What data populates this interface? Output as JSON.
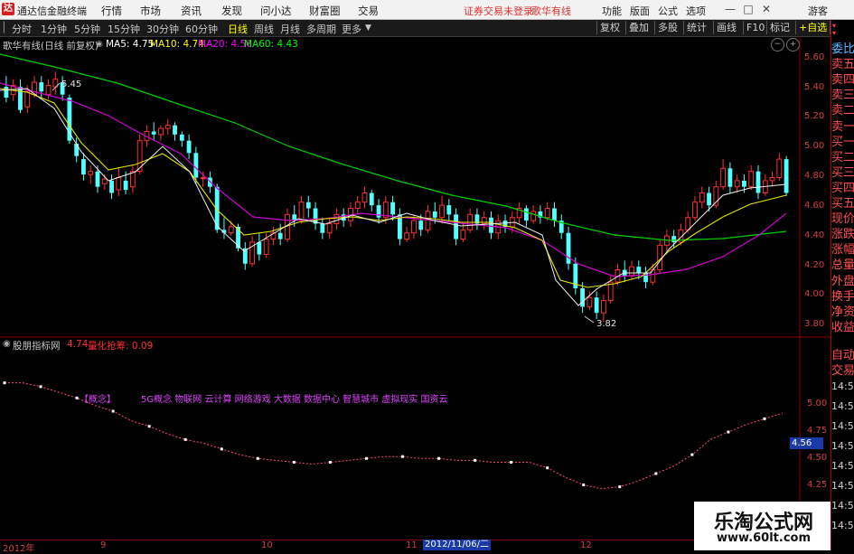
{
  "titlebar": {
    "logo": "达",
    "app_title": "通达信金融终端",
    "menus": [
      "行情",
      "市场",
      "资讯",
      "发现",
      "问小达",
      "财富圈",
      "交易"
    ],
    "warning": "证券交易未登录",
    "stock_name": "歌华有线",
    "right_menus": [
      "功能",
      "版面",
      "公式",
      "选项"
    ],
    "guest": "游客",
    "win_min": "—",
    "win_max": "□",
    "win_close": "✕"
  },
  "toolbar": {
    "periods": [
      "分时",
      "1分钟",
      "5分钟",
      "15分钟",
      "30分钟",
      "60分钟",
      "日线",
      "周线",
      "月线",
      "多周期",
      "更多"
    ],
    "selected": "日线",
    "right_buttons": [
      "复权",
      "叠加",
      "多股",
      "统计",
      "画线",
      "F10",
      "标记",
      "+自选",
      "返回"
    ]
  },
  "chart_header": {
    "name": "歌华有线(日线 前复权)",
    "ma5": "MA5: 4.75",
    "ma10": "MA10: 4.74",
    "ma20": "MA20: 4.56",
    "ma60": "MA60: 4.43",
    "colors": {
      "ma5": "#ffffff",
      "ma10": "#ffff00",
      "ma20": "#ff00ff",
      "ma60": "#00ff00"
    }
  },
  "indicator_header": {
    "name": "股朋指标网",
    "value": "4.74",
    "label2": "量化抢筹: 0.09",
    "concept": "【概念】",
    "concept_text": "5G概念 物联网 云计算 网络游戏 大数据 数据中心 智慧城市 虚拟现实 国资云",
    "current_tag": "4.56"
  },
  "side_panel": {
    "top_labels": [
      "委比",
      "卖五",
      "卖四",
      "卖三",
      "卖二",
      "卖一",
      "买一",
      "买二",
      "买三",
      "买四",
      "买五",
      "现价",
      "涨跌",
      "涨幅",
      "总量",
      "外盘",
      "换手",
      "净资",
      "收益"
    ],
    "lower_labels": [
      "自动",
      "交易"
    ],
    "times": [
      "14:56",
      "14:56",
      "14:56",
      "14:56",
      "14:56",
      "14:56",
      "14:56",
      "14:56"
    ]
  },
  "price_axis": [
    "5.60",
    "5.40",
    "5.20",
    "5.00",
    "4.80",
    "4.60",
    "4.40",
    "4.20",
    "4.00",
    "3.80"
  ],
  "indicator_axis": [
    "5.00",
    "4.75",
    "4.50",
    "4.25"
  ],
  "annotations": {
    "high": "5.45",
    "low": "3.82"
  },
  "timeline": {
    "labels": [
      "2012年",
      "9",
      "10",
      "11",
      "12"
    ],
    "cursor_date": "2012/11/06/二"
  },
  "watermark": {
    "line1": "乐淘公式网",
    "line2": "www.60lt.com"
  },
  "chart_data": {
    "type": "candlestick",
    "colors": {
      "up": "#ff3030",
      "down": "#54ffff"
    },
    "ylim": [
      3.74,
      5.68
    ],
    "candles": [
      [
        5.35,
        5.28,
        5.42,
        5.25
      ],
      [
        5.3,
        5.36,
        5.4,
        5.26
      ],
      [
        5.35,
        5.2,
        5.4,
        5.18
      ],
      [
        5.22,
        5.32,
        5.36,
        5.18
      ],
      [
        5.3,
        5.38,
        5.42,
        5.28
      ],
      [
        5.38,
        5.32,
        5.42,
        5.28
      ],
      [
        5.3,
        5.36,
        5.4,
        5.27
      ],
      [
        5.35,
        5.4,
        5.45,
        5.3
      ],
      [
        5.38,
        5.3,
        5.42,
        5.26
      ],
      [
        5.28,
        5.0,
        5.3,
        4.98
      ],
      [
        4.98,
        4.9,
        5.02,
        4.86
      ],
      [
        4.88,
        4.78,
        4.92,
        4.74
      ],
      [
        4.78,
        4.8,
        4.84,
        4.72
      ],
      [
        4.8,
        4.7,
        4.84,
        4.66
      ],
      [
        4.72,
        4.75,
        4.78,
        4.68
      ],
      [
        4.74,
        4.66,
        4.78,
        4.62
      ],
      [
        4.68,
        4.76,
        4.82,
        4.64
      ],
      [
        4.74,
        4.68,
        4.8,
        4.65
      ],
      [
        4.7,
        4.8,
        4.84,
        4.66
      ],
      [
        4.8,
        5.0,
        5.04,
        4.78
      ],
      [
        5.0,
        5.06,
        5.1,
        4.96
      ],
      [
        5.06,
        5.04,
        5.12,
        5.0
      ],
      [
        5.04,
        5.08,
        5.1,
        5.0
      ],
      [
        5.08,
        5.1,
        5.14,
        5.04
      ],
      [
        5.1,
        5.04,
        5.12,
        5.0
      ],
      [
        5.04,
        5.0,
        5.06,
        4.96
      ],
      [
        5.0,
        4.92,
        5.04,
        4.88
      ],
      [
        4.92,
        4.76,
        4.96,
        4.72
      ],
      [
        4.76,
        4.76,
        4.8,
        4.7
      ],
      [
        4.76,
        4.7,
        4.8,
        4.66
      ],
      [
        4.7,
        4.42,
        4.72,
        4.4
      ],
      [
        4.42,
        4.4,
        4.5,
        4.36
      ],
      [
        4.4,
        4.44,
        4.48,
        4.38
      ],
      [
        4.44,
        4.3,
        4.46,
        4.28
      ],
      [
        4.3,
        4.2,
        4.34,
        4.16
      ],
      [
        4.2,
        4.34,
        4.38,
        4.18
      ],
      [
        4.34,
        4.26,
        4.4,
        4.22
      ],
      [
        4.26,
        4.36,
        4.4,
        4.24
      ],
      [
        4.36,
        4.4,
        4.44,
        4.32
      ],
      [
        4.4,
        4.36,
        4.46,
        4.32
      ],
      [
        4.36,
        4.52,
        4.56,
        4.34
      ],
      [
        4.52,
        4.48,
        4.58,
        4.44
      ],
      [
        4.48,
        4.6,
        4.64,
        4.46
      ],
      [
        4.6,
        4.56,
        4.64,
        4.5
      ],
      [
        4.56,
        4.46,
        4.6,
        4.42
      ],
      [
        4.46,
        4.4,
        4.5,
        4.36
      ],
      [
        4.4,
        4.46,
        4.5,
        4.36
      ],
      [
        4.46,
        4.52,
        4.56,
        4.42
      ],
      [
        4.52,
        4.48,
        4.56,
        4.44
      ],
      [
        4.48,
        4.56,
        4.6,
        4.44
      ],
      [
        4.56,
        4.6,
        4.64,
        4.52
      ],
      [
        4.6,
        4.66,
        4.7,
        4.56
      ],
      [
        4.66,
        4.58,
        4.68,
        4.54
      ],
      [
        4.58,
        4.5,
        4.62,
        4.46
      ],
      [
        4.5,
        4.6,
        4.64,
        4.46
      ],
      [
        4.6,
        4.52,
        4.64,
        4.48
      ],
      [
        4.52,
        4.36,
        4.56,
        4.32
      ],
      [
        4.36,
        4.4,
        4.44,
        4.34
      ],
      [
        4.4,
        4.48,
        4.52,
        4.36
      ],
      [
        4.48,
        4.42,
        4.52,
        4.38
      ],
      [
        4.42,
        4.54,
        4.58,
        4.4
      ],
      [
        4.54,
        4.5,
        4.6,
        4.46
      ],
      [
        4.5,
        4.58,
        4.64,
        4.46
      ],
      [
        4.58,
        4.52,
        4.62,
        4.48
      ],
      [
        4.52,
        4.36,
        4.56,
        4.32
      ],
      [
        4.36,
        4.42,
        4.46,
        4.34
      ],
      [
        4.42,
        4.52,
        4.56,
        4.4
      ],
      [
        4.52,
        4.46,
        4.56,
        4.42
      ],
      [
        4.46,
        4.5,
        4.54,
        4.42
      ],
      [
        4.5,
        4.4,
        4.54,
        4.36
      ],
      [
        4.4,
        4.48,
        4.52,
        4.36
      ],
      [
        4.48,
        4.44,
        4.52,
        4.4
      ],
      [
        4.44,
        4.5,
        4.54,
        4.4
      ],
      [
        4.5,
        4.56,
        4.6,
        4.46
      ],
      [
        4.56,
        4.48,
        4.58,
        4.44
      ],
      [
        4.48,
        4.54,
        4.58,
        4.46
      ],
      [
        4.54,
        4.5,
        4.58,
        4.46
      ],
      [
        4.5,
        4.56,
        4.6,
        4.48
      ],
      [
        4.56,
        4.48,
        4.6,
        4.44
      ],
      [
        4.48,
        4.4,
        4.52,
        4.36
      ],
      [
        4.4,
        4.2,
        4.44,
        4.16
      ],
      [
        4.2,
        4.04,
        4.24,
        4.0
      ],
      [
        4.04,
        3.92,
        4.08,
        3.88
      ],
      [
        3.92,
        3.98,
        4.02,
        3.9
      ],
      [
        3.98,
        3.88,
        4.02,
        3.84
      ],
      [
        3.88,
        3.96,
        4.0,
        3.82
      ],
      [
        3.96,
        4.08,
        4.12,
        3.94
      ],
      [
        4.08,
        4.16,
        4.2,
        4.06
      ],
      [
        4.16,
        4.12,
        4.22,
        4.08
      ],
      [
        4.12,
        4.18,
        4.22,
        4.1
      ],
      [
        4.18,
        4.14,
        4.22,
        4.1
      ],
      [
        4.14,
        4.08,
        4.18,
        4.04
      ],
      [
        4.08,
        4.16,
        4.2,
        4.06
      ],
      [
        4.16,
        4.32,
        4.36,
        4.14
      ],
      [
        4.32,
        4.38,
        4.42,
        4.28
      ],
      [
        4.38,
        4.34,
        4.42,
        4.3
      ],
      [
        4.34,
        4.42,
        4.46,
        4.32
      ],
      [
        4.42,
        4.5,
        4.54,
        4.4
      ],
      [
        4.5,
        4.6,
        4.64,
        4.48
      ],
      [
        4.6,
        4.66,
        4.7,
        4.56
      ],
      [
        4.66,
        4.58,
        4.7,
        4.54
      ],
      [
        4.58,
        4.7,
        4.74,
        4.56
      ],
      [
        4.7,
        4.82,
        4.88,
        4.68
      ],
      [
        4.82,
        4.7,
        4.86,
        4.66
      ],
      [
        4.7,
        4.74,
        4.78,
        4.66
      ],
      [
        4.74,
        4.7,
        4.78,
        4.66
      ],
      [
        4.7,
        4.8,
        4.84,
        4.68
      ],
      [
        4.8,
        4.66,
        4.84,
        4.62
      ],
      [
        4.66,
        4.74,
        4.78,
        4.64
      ],
      [
        4.74,
        4.76,
        4.8,
        4.7
      ],
      [
        4.76,
        4.88,
        4.92,
        4.74
      ],
      [
        4.88,
        4.66,
        4.9,
        4.64
      ]
    ],
    "indicator_values": [
      4.9,
      4.9,
      4.88,
      4.85,
      4.82,
      4.78,
      4.75,
      4.7,
      4.67,
      4.63,
      4.6,
      4.58,
      4.55,
      4.52,
      4.5,
      4.49,
      4.48,
      4.47,
      4.48,
      4.49,
      4.5,
      4.51,
      4.51,
      4.5,
      4.5,
      4.49,
      4.49,
      4.48,
      4.48,
      4.48,
      4.45,
      4.4,
      4.36,
      4.34,
      4.35,
      4.38,
      4.42,
      4.46,
      4.52,
      4.6,
      4.64,
      4.68,
      4.71,
      4.74
    ]
  }
}
